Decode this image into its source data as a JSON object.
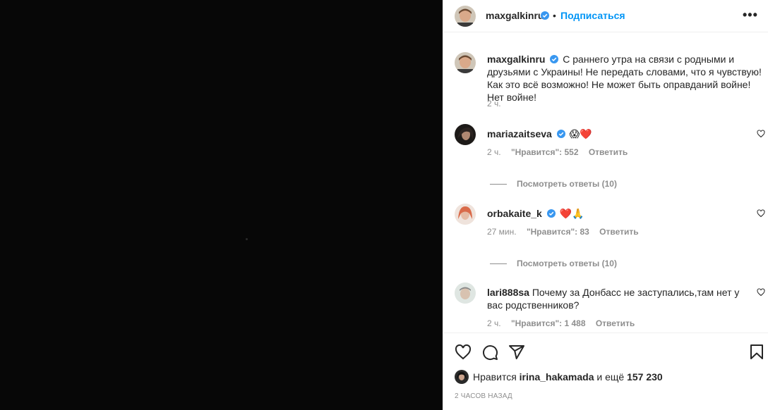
{
  "post": {
    "author": "maxgalkinru",
    "follow_label": "Подписаться",
    "dot": "•",
    "more": "•••"
  },
  "caption": {
    "username": "maxgalkinru",
    "text": "С раннего утра на связи с родными и друзьями с Украины! Не передать словами, что я чувствую! Как это всё возможно! Не может быть оправданий войне! Нет войне!",
    "time": "2 ч."
  },
  "comments": [
    {
      "username": "mariazaitseva",
      "verified": true,
      "text": "😱❤️",
      "time": "2 ч.",
      "likes": "\"Нравится\": 552",
      "reply": "Ответить",
      "view_replies": "Посмотреть ответы (10)"
    },
    {
      "username": "orbakaite_k",
      "verified": true,
      "text": "❤️🙏",
      "time": "27 мин.",
      "likes": "\"Нравится\": 83",
      "reply": "Ответить",
      "view_replies": "Посмотреть ответы (10)"
    },
    {
      "username": "lari888sa",
      "verified": false,
      "text": "Почему за Донбасс не заступались,там нет у вас родственников?",
      "time": "2 ч.",
      "likes": "\"Нравится\": 1 488",
      "reply": "Ответить"
    }
  ],
  "footer": {
    "liked_prefix": "Нравится",
    "liked_user": "irina_hakamada",
    "liked_mid": "и ещё",
    "liked_count": "157 230",
    "time_ago": "2 ЧАСОВ НАЗАД"
  },
  "colors": {
    "accent": "#0095f6",
    "verified": "#3897f0",
    "muted": "#8e8e8e",
    "media_bg": "#070707"
  }
}
